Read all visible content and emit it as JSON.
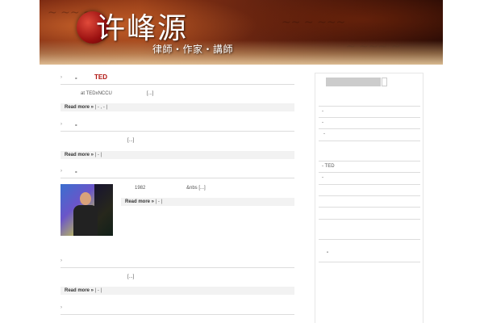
{
  "header": {
    "logo_text": "许峰源",
    "tagline": "律師・作家・講師"
  },
  "posts": [
    {
      "bullet": "›",
      "dash": "-",
      "title": "TED",
      "excerpt_prefix": "at TEDxNCCU",
      "excerpt_suffix": "[...]",
      "read_more": "Read more »",
      "meta": "|      -       ,       -     |"
    },
    {
      "bullet": "›",
      "dash": "-",
      "title": "",
      "excerpt_suffix": "[...]",
      "read_more": "Read more »",
      "meta": "|      -       |"
    },
    {
      "bullet": "›",
      "dash": "-",
      "title": "",
      "excerpt_prefix": "1982",
      "excerpt_suffix": "&nbs [...]",
      "read_more": "Read more »",
      "meta": "|       -       |"
    },
    {
      "bullet": "›",
      "excerpt_suffix": "[...]",
      "read_more": "Read more »",
      "meta": "|      -          |"
    },
    {
      "bullet": "›"
    }
  ],
  "sidebar": {
    "items": [
      "-",
      "-",
      "-",
      "-  TED",
      "-"
    ],
    "bottom_item": "-"
  }
}
